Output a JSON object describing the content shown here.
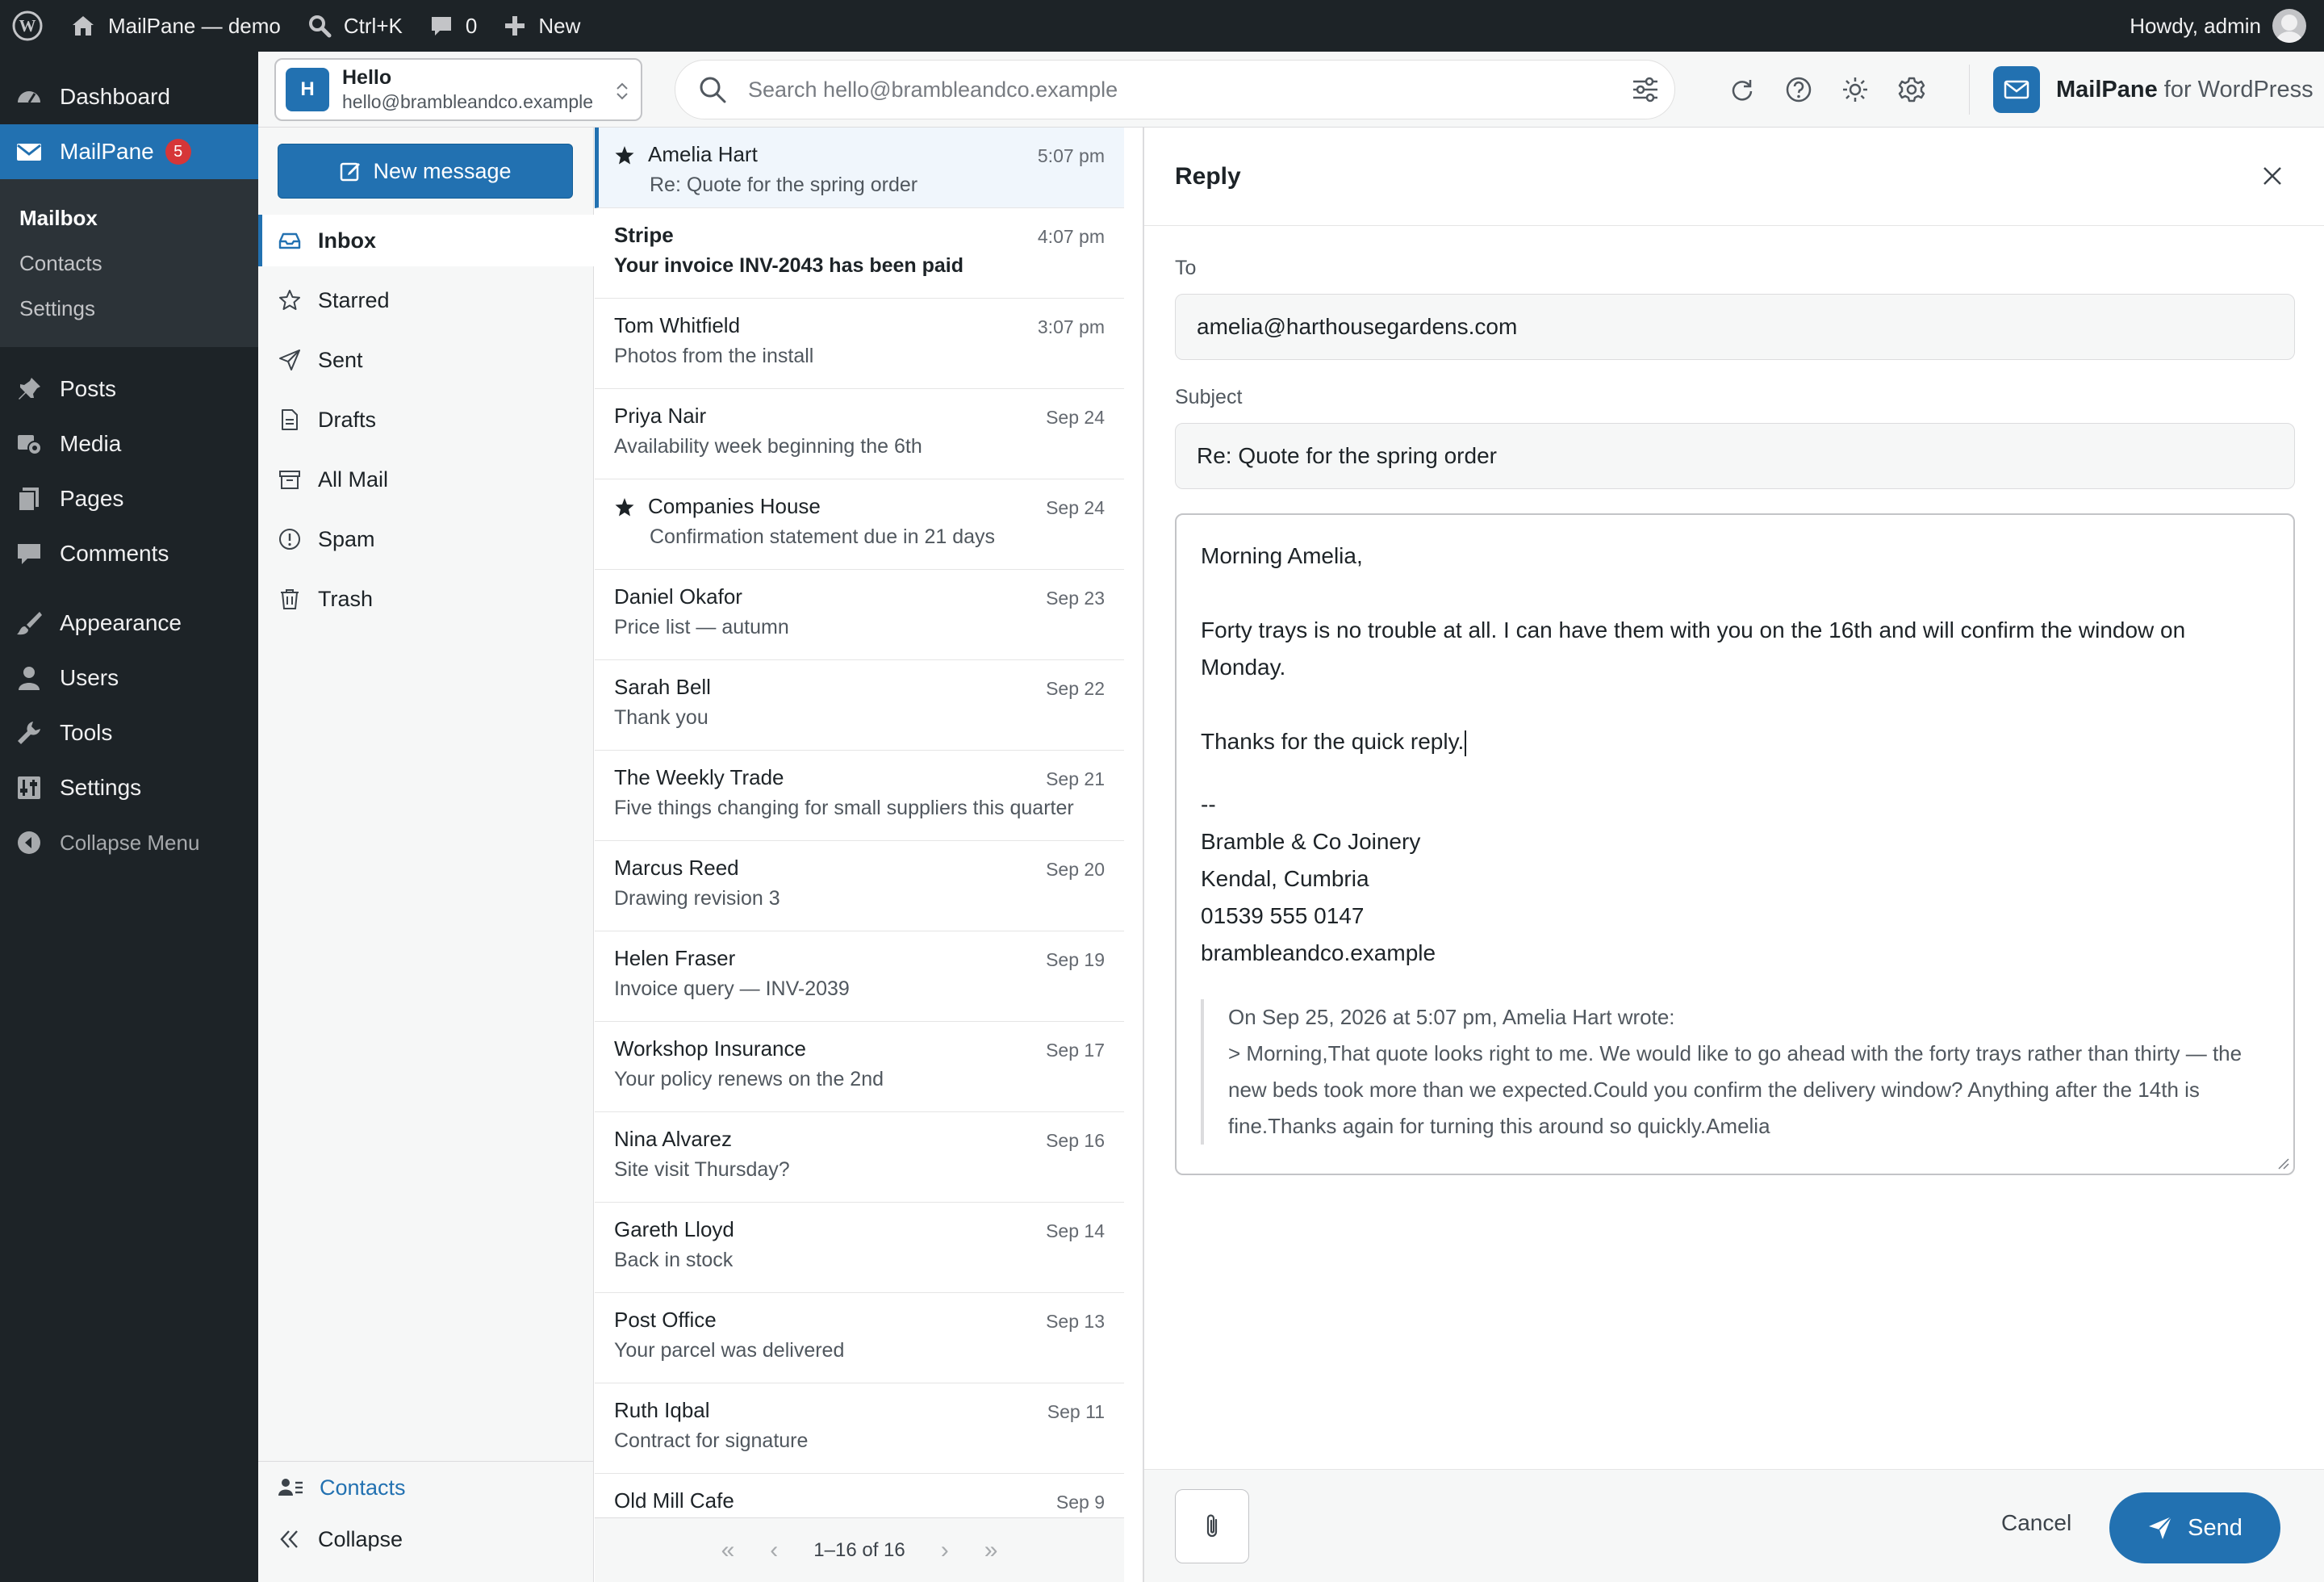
{
  "adminbar": {
    "site_name": "MailPane — demo",
    "shortcut": "Ctrl+K",
    "comments_count": "0",
    "new_label": "New",
    "howdy": "Howdy, admin"
  },
  "wp_menu": {
    "dashboard": "Dashboard",
    "mailpane": "MailPane",
    "mailpane_badge": "5",
    "submenu": [
      "Mailbox",
      "Contacts",
      "Settings"
    ],
    "posts": "Posts",
    "media": "Media",
    "pages": "Pages",
    "comments": "Comments",
    "appearance": "Appearance",
    "users": "Users",
    "tools": "Tools",
    "settings": "Settings",
    "collapse": "Collapse Menu"
  },
  "account": {
    "initial": "H",
    "name": "Hello",
    "email": "hello@brambleandco.example"
  },
  "search": {
    "placeholder": "Search hello@brambleandco.example"
  },
  "brand": {
    "name": "MailPane",
    "suffix": "for WordPress"
  },
  "folders": {
    "new_message": "New message",
    "items": [
      "Inbox",
      "Starred",
      "Sent",
      "Drafts",
      "All Mail",
      "Spam",
      "Trash"
    ],
    "contacts": "Contacts",
    "collapse": "Collapse"
  },
  "messages": [
    {
      "from": "Amelia Hart",
      "subject": "Re: Quote for the spring order",
      "date": "5:07 pm",
      "starred": true,
      "unread": false,
      "selected": true
    },
    {
      "from": "Stripe",
      "subject": "Your invoice INV-2043 has been paid",
      "date": "4:07 pm",
      "starred": false,
      "unread": true,
      "selected": false
    },
    {
      "from": "Tom Whitfield",
      "subject": "Photos from the install",
      "date": "3:07 pm",
      "starred": false,
      "unread": false,
      "selected": false
    },
    {
      "from": "Priya Nair",
      "subject": "Availability week beginning the 6th",
      "date": "Sep 24",
      "starred": false,
      "unread": false,
      "selected": false
    },
    {
      "from": "Companies House",
      "subject": "Confirmation statement due in 21 days",
      "date": "Sep 24",
      "starred": true,
      "unread": false,
      "selected": false
    },
    {
      "from": "Daniel Okafor",
      "subject": "Price list — autumn",
      "date": "Sep 23",
      "starred": false,
      "unread": false,
      "selected": false
    },
    {
      "from": "Sarah Bell",
      "subject": "Thank you",
      "date": "Sep 22",
      "starred": false,
      "unread": false,
      "selected": false
    },
    {
      "from": "The Weekly Trade",
      "subject": "Five things changing for small suppliers this quarter",
      "date": "Sep 21",
      "starred": false,
      "unread": false,
      "selected": false
    },
    {
      "from": "Marcus Reed",
      "subject": "Drawing revision 3",
      "date": "Sep 20",
      "starred": false,
      "unread": false,
      "selected": false
    },
    {
      "from": "Helen Fraser",
      "subject": "Invoice query — INV-2039",
      "date": "Sep 19",
      "starred": false,
      "unread": false,
      "selected": false
    },
    {
      "from": "Workshop Insurance",
      "subject": "Your policy renews on the 2nd",
      "date": "Sep 17",
      "starred": false,
      "unread": false,
      "selected": false
    },
    {
      "from": "Nina Alvarez",
      "subject": "Site visit Thursday?",
      "date": "Sep 16",
      "starred": false,
      "unread": false,
      "selected": false
    },
    {
      "from": "Gareth Lloyd",
      "subject": "Back in stock",
      "date": "Sep 14",
      "starred": false,
      "unread": false,
      "selected": false
    },
    {
      "from": "Post Office",
      "subject": "Your parcel was delivered",
      "date": "Sep 13",
      "starred": false,
      "unread": false,
      "selected": false
    },
    {
      "from": "Ruth Iqbal",
      "subject": "Contract for signature",
      "date": "Sep 11",
      "starred": false,
      "unread": false,
      "selected": false
    },
    {
      "from": "Old Mill Cafe",
      "subject": "",
      "date": "Sep 9",
      "starred": false,
      "unread": false,
      "selected": false
    }
  ],
  "pager": {
    "range": "1–16 of 16"
  },
  "reply": {
    "title": "Reply",
    "to_label": "To",
    "to_value": "amelia@harthousegardens.com",
    "subject_label": "Subject",
    "subject_value": "Re: Quote for the spring order",
    "greeting": "Morning Amelia,",
    "paragraph": "Forty trays is no trouble at all. I can have them with you on the 16th and will confirm the window on Monday.",
    "thanks": "Thanks for the quick reply.",
    "signature": [
      "--",
      "Bramble & Co Joinery",
      "Kendal, Cumbria",
      "01539 555 0147",
      "brambleandco.example"
    ],
    "quote_header": "On Sep 25, 2026 at 5:07 pm, Amelia Hart wrote:",
    "quote_text": "> Morning,That quote looks right to me. We would like to go ahead with the forty trays rather than thirty — the new beds took more than we expected.Could you confirm the delivery window? Anything after the 14th is fine.Thanks again for turning this around so quickly.Amelia",
    "cancel": "Cancel",
    "send": "Send"
  }
}
